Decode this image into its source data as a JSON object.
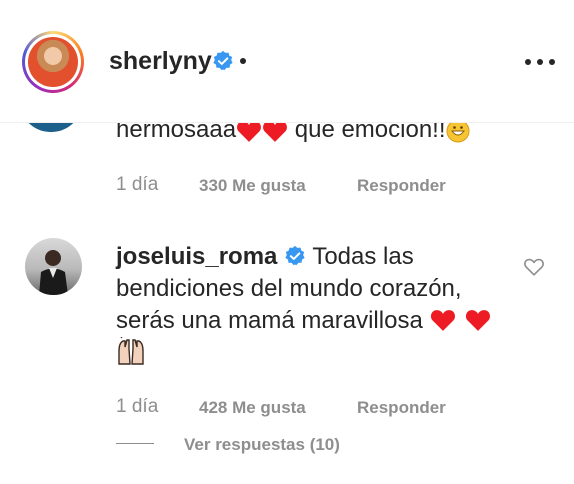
{
  "header": {
    "username": "sherlyny",
    "verified_color": "#3897f0"
  },
  "previous_comment": {
    "text": "hermosaaa",
    "text_after": "que emocion!!",
    "time": "1 día",
    "likes": "330 Me gusta",
    "reply_label": "Responder"
  },
  "comment": {
    "username": "joseluis_roma",
    "text": "Todas las bendiciones del mundo corazón, serás una mamá maravillosa",
    "time": "1 día",
    "likes": "428 Me gusta",
    "reply_label": "Responder",
    "view_replies": "Ver respuestas (10)"
  },
  "colors": {
    "text": "#262626",
    "muted": "#8e8e8e",
    "heart_red": "#ed1c24",
    "verified": "#3897f0"
  },
  "icons": [
    "verified-badge-icon",
    "more-options-icon",
    "red-heart-icon",
    "grinning-emoji-icon",
    "raising-hands-icon",
    "like-heart-icon"
  ]
}
